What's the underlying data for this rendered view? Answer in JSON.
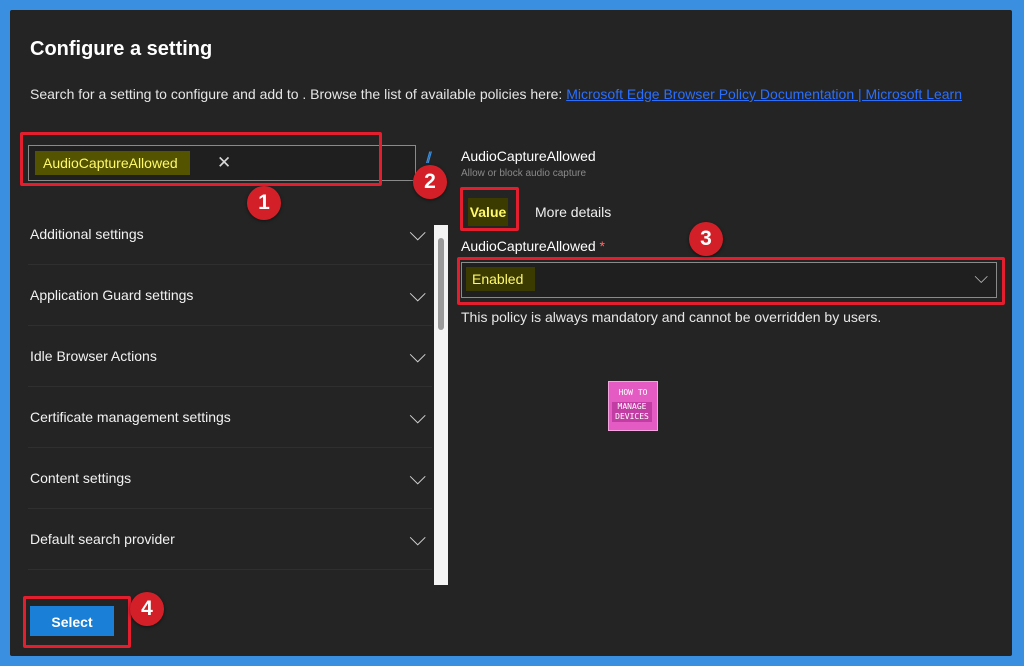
{
  "page": {
    "title": "Configure a setting",
    "description": "Search for a setting to configure and add to . Browse the list of available policies here:",
    "doc_link": "Microsoft Edge Browser Policy Documentation | Microsoft Learn"
  },
  "search": {
    "chip_value": "AudioCaptureAllowed",
    "clear_glyph": "✕"
  },
  "settings_list": [
    {
      "label": "Additional settings"
    },
    {
      "label": "Application Guard settings"
    },
    {
      "label": "Idle Browser Actions"
    },
    {
      "label": "Certificate management settings"
    },
    {
      "label": "Content settings"
    },
    {
      "label": "Default search provider"
    }
  ],
  "right_panel": {
    "setting_name": "AudioCaptureAllowed",
    "setting_desc": "Allow or block audio capture",
    "tabs": {
      "value": "Value",
      "more": "More details"
    },
    "field_label": "AudioCaptureAllowed",
    "required_mark": "*",
    "selected_value": "Enabled",
    "note": "This policy is always mandatory and cannot be overridden by users."
  },
  "logo": {
    "top_text": "HOW TO",
    "bottom_text": "MANAGE DEVICES"
  },
  "footer": {
    "select_label": "Select"
  },
  "annotations": {
    "one": "1",
    "two": "2",
    "three": "3",
    "four": "4"
  },
  "icons": {
    "chevron": "chevron-down-icon",
    "collapse": "collapse-icon"
  },
  "colors": {
    "accent": "#1a7fd6",
    "highlight": "#e31e2f",
    "chip_text": "#fffa6b",
    "link": "#2b6fff"
  }
}
